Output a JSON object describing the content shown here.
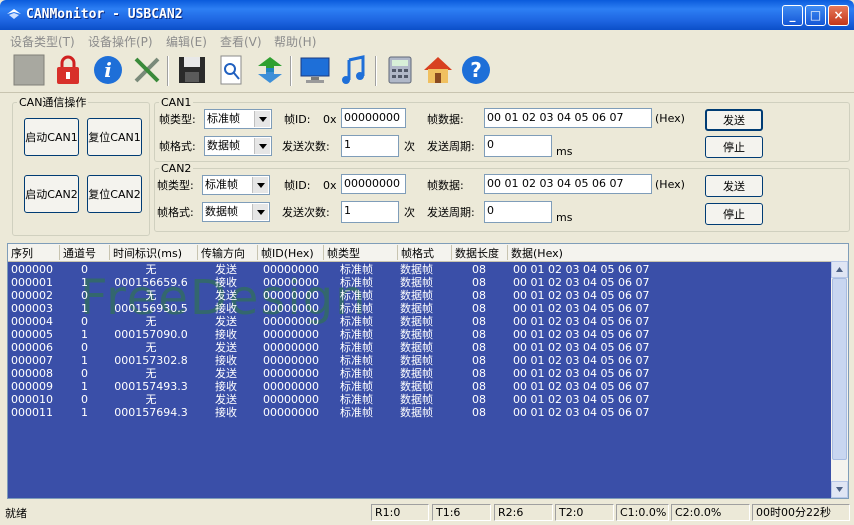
{
  "window": {
    "title": "CANMonitor - USBCAN2",
    "buttons": {
      "minimize": "_",
      "maximize": "□",
      "close": "×"
    }
  },
  "menu": [
    "设备类型(T)",
    "设备操作(P)",
    "编辑(E)",
    "查看(V)",
    "帮助(H)"
  ],
  "toolbar": {
    "icons": [
      "blank-icon",
      "lock-icon",
      "info-icon",
      "tools-icon",
      "save-icon",
      "find-icon",
      "refresh-icon",
      "monitor-icon",
      "music-icon",
      "calculator-icon",
      "home-icon",
      "help-icon"
    ]
  },
  "can_ops": {
    "legend": "CAN通信操作",
    "start_can1": "启动CAN1",
    "reset_can1": "复位CAN1",
    "start_can2": "启动CAN2",
    "reset_can2": "复位CAN2"
  },
  "can1": {
    "legend": "CAN1",
    "frame_type_label": "帧类型:",
    "frame_type": "标准帧",
    "frame_id_label": "帧ID:",
    "ox": "0x",
    "frame_id": "00000000",
    "data_label": "帧数据:",
    "data": "00 01 02 03 04 05 06 07",
    "hex": "(Hex)",
    "send": "发送",
    "frame_format_label": "帧格式:",
    "frame_format": "数据帧",
    "send_count_label": "发送次数:",
    "send_count": "1",
    "times": "次",
    "period_label": "发送周期:",
    "period": "0",
    "ms": "ms",
    "stop": "停止"
  },
  "can2": {
    "legend": "CAN2",
    "frame_type_label": "帧类型:",
    "frame_type": "标准帧",
    "frame_id_label": "帧ID:",
    "ox": "0x",
    "frame_id": "00000000",
    "data_label": "帧数据:",
    "data": "00 01 02 03 04 05 06 07",
    "hex": "(Hex)",
    "send": "发送",
    "frame_format_label": "帧格式:",
    "frame_format": "数据帧",
    "send_count_label": "发送次数:",
    "send_count": "1",
    "times": "次",
    "period_label": "发送周期:",
    "period": "0",
    "ms": "ms",
    "stop": "停止"
  },
  "table": {
    "columns": [
      "序列",
      "通道号",
      "时间标识(ms)",
      "传输方向",
      "帧ID(Hex)",
      "帧类型",
      "帧格式",
      "数据长度",
      "数据(Hex)"
    ],
    "rows": [
      [
        "000000",
        "0",
        "无",
        "发送",
        "00000000",
        "标准帧",
        "数据帧",
        "08",
        "00 01 02 03 04 05 06 07"
      ],
      [
        "000001",
        "1",
        "000156659.6",
        "接收",
        "00000000",
        "标准帧",
        "数据帧",
        "08",
        "00 01 02 03 04 05 06 07"
      ],
      [
        "000002",
        "0",
        "无",
        "发送",
        "00000000",
        "标准帧",
        "数据帧",
        "08",
        "00 01 02 03 04 05 06 07"
      ],
      [
        "000003",
        "1",
        "000156930.5",
        "接收",
        "00000000",
        "标准帧",
        "数据帧",
        "08",
        "00 01 02 03 04 05 06 07"
      ],
      [
        "000004",
        "0",
        "无",
        "发送",
        "00000000",
        "标准帧",
        "数据帧",
        "08",
        "00 01 02 03 04 05 06 07"
      ],
      [
        "000005",
        "1",
        "000157090.0",
        "接收",
        "00000000",
        "标准帧",
        "数据帧",
        "08",
        "00 01 02 03 04 05 06 07"
      ],
      [
        "000006",
        "0",
        "无",
        "发送",
        "00000000",
        "标准帧",
        "数据帧",
        "08",
        "00 01 02 03 04 05 06 07"
      ],
      [
        "000007",
        "1",
        "000157302.8",
        "接收",
        "00000000",
        "标准帧",
        "数据帧",
        "08",
        "00 01 02 03 04 05 06 07"
      ],
      [
        "000008",
        "0",
        "无",
        "发送",
        "00000000",
        "标准帧",
        "数据帧",
        "08",
        "00 01 02 03 04 05 06 07"
      ],
      [
        "000009",
        "1",
        "000157493.3",
        "接收",
        "00000000",
        "标准帧",
        "数据帧",
        "08",
        "00 01 02 03 04 05 06 07"
      ],
      [
        "000010",
        "0",
        "无",
        "发送",
        "00000000",
        "标准帧",
        "数据帧",
        "08",
        "00 01 02 03 04 05 06 07"
      ],
      [
        "000011",
        "1",
        "000157694.3",
        "接收",
        "00000000",
        "标准帧",
        "数据帧",
        "08",
        "00 01 02 03 04 05 06 07"
      ]
    ],
    "watermark": "FreeDesign"
  },
  "status": {
    "ready": "就绪",
    "r1": "R1:0",
    "t1": "T1:6",
    "r2": "R2:6",
    "t2": "T2:0",
    "c1": "C1:0.0%",
    "c2": "C2:0.0%",
    "elapsed": "00时00分22秒"
  },
  "colors": {
    "title": "#0A5BDC",
    "list_bg": "#3A4FA8",
    "face": "#ECE9D8"
  }
}
